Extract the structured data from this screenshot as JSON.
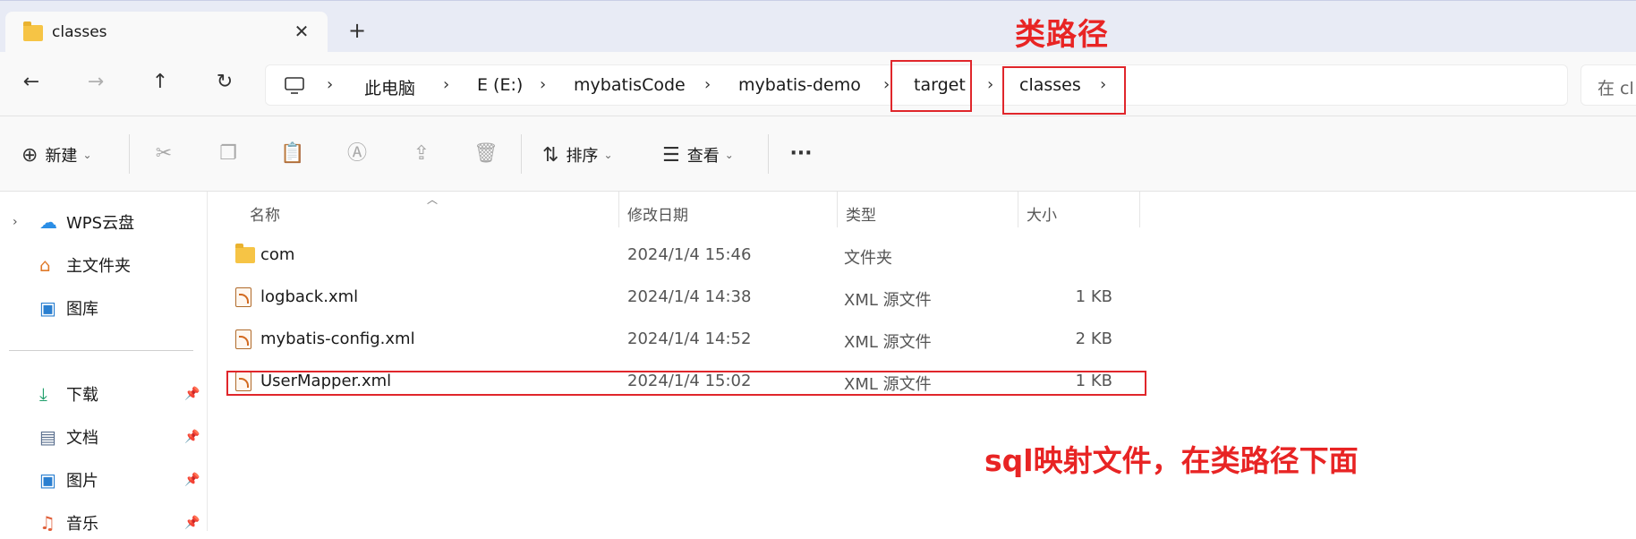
{
  "window": {
    "tab_title": "classes",
    "close_glyph": "✕",
    "newtab_glyph": "+"
  },
  "annotations": {
    "classpath_label": "类路径",
    "mapper_note": "sql映射文件，在类路径下面",
    "highlight_color": "#e0262b"
  },
  "nav": {
    "back_glyph": "←",
    "forward_glyph": "→",
    "up_glyph": "↑",
    "refresh_glyph": "↻",
    "breadcrumb": [
      "此电脑",
      "E (E:)",
      "mybatisCode",
      "mybatis-demo",
      "target",
      "classes"
    ],
    "separator": "›",
    "search_placeholder": "在 cl"
  },
  "toolbar": {
    "new_label": "新建",
    "sort_label": "排序",
    "view_label": "查看",
    "more_glyph": "···",
    "icons": [
      "plus-circle-icon",
      "cut-icon",
      "copy-icon",
      "paste-icon",
      "rename-icon",
      "share-icon",
      "delete-icon",
      "sort-icon",
      "view-icon",
      "more-icon"
    ]
  },
  "sidebar": {
    "items": [
      {
        "label": "WPS云盘",
        "icon": "cloud-icon",
        "expandable": true,
        "pinned": false
      },
      {
        "label": "主文件夹",
        "icon": "home-icon",
        "expandable": false,
        "pinned": false
      },
      {
        "label": "图库",
        "icon": "gallery-icon",
        "expandable": false,
        "pinned": false
      },
      {
        "label": "下载",
        "icon": "download-icon",
        "expandable": false,
        "pinned": true
      },
      {
        "label": "文档",
        "icon": "document-icon",
        "expandable": false,
        "pinned": true
      },
      {
        "label": "图片",
        "icon": "picture-icon",
        "expandable": false,
        "pinned": true
      },
      {
        "label": "音乐",
        "icon": "music-icon",
        "expandable": false,
        "pinned": true
      }
    ]
  },
  "table": {
    "columns": [
      "名称",
      "修改日期",
      "类型",
      "大小"
    ],
    "rows": [
      {
        "name": "com",
        "date": "2024/1/4 15:46",
        "type": "文件夹",
        "size": "",
        "icon": "folder-icon"
      },
      {
        "name": "logback.xml",
        "date": "2024/1/4 14:38",
        "type": "XML 源文件",
        "size": "1 KB",
        "icon": "xml-file-icon"
      },
      {
        "name": "mybatis-config.xml",
        "date": "2024/1/4 14:52",
        "type": "XML 源文件",
        "size": "2 KB",
        "icon": "xml-file-icon"
      },
      {
        "name": "UserMapper.xml",
        "date": "2024/1/4 15:02",
        "type": "XML 源文件",
        "size": "1 KB",
        "icon": "xml-file-icon"
      }
    ]
  }
}
